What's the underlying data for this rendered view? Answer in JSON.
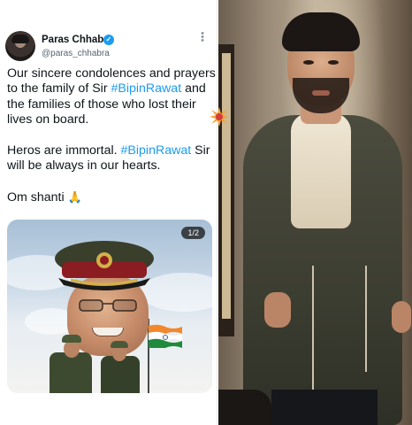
{
  "tweet": {
    "author_name": "Paras Chhabra",
    "author_handle": "@paras_chhabra",
    "text_line_1_pre": "Our sincere condolences and prayers to the family of Sir ",
    "hashtag_1": "#BipinRawat",
    "text_line_1_post": " and the families of those who lost their lives on board.",
    "text_line_2_pre": "Heros are immortal. ",
    "hashtag_2": "#BipinRawat",
    "text_line_2_post": " Sir will be always in our hearts.",
    "text_line_3": "Om shanti",
    "emoji": "🙏",
    "media_counter": "1/2"
  },
  "icons": {
    "verified": "verified-badge-icon",
    "more": "more-options-icon",
    "emoji": "folded-hands-icon",
    "separator": "burst-icon"
  },
  "colors": {
    "hashtag": "#1d9bf0",
    "verified": "#1d9bf0",
    "text": "#0f1419",
    "handle": "#536471"
  }
}
